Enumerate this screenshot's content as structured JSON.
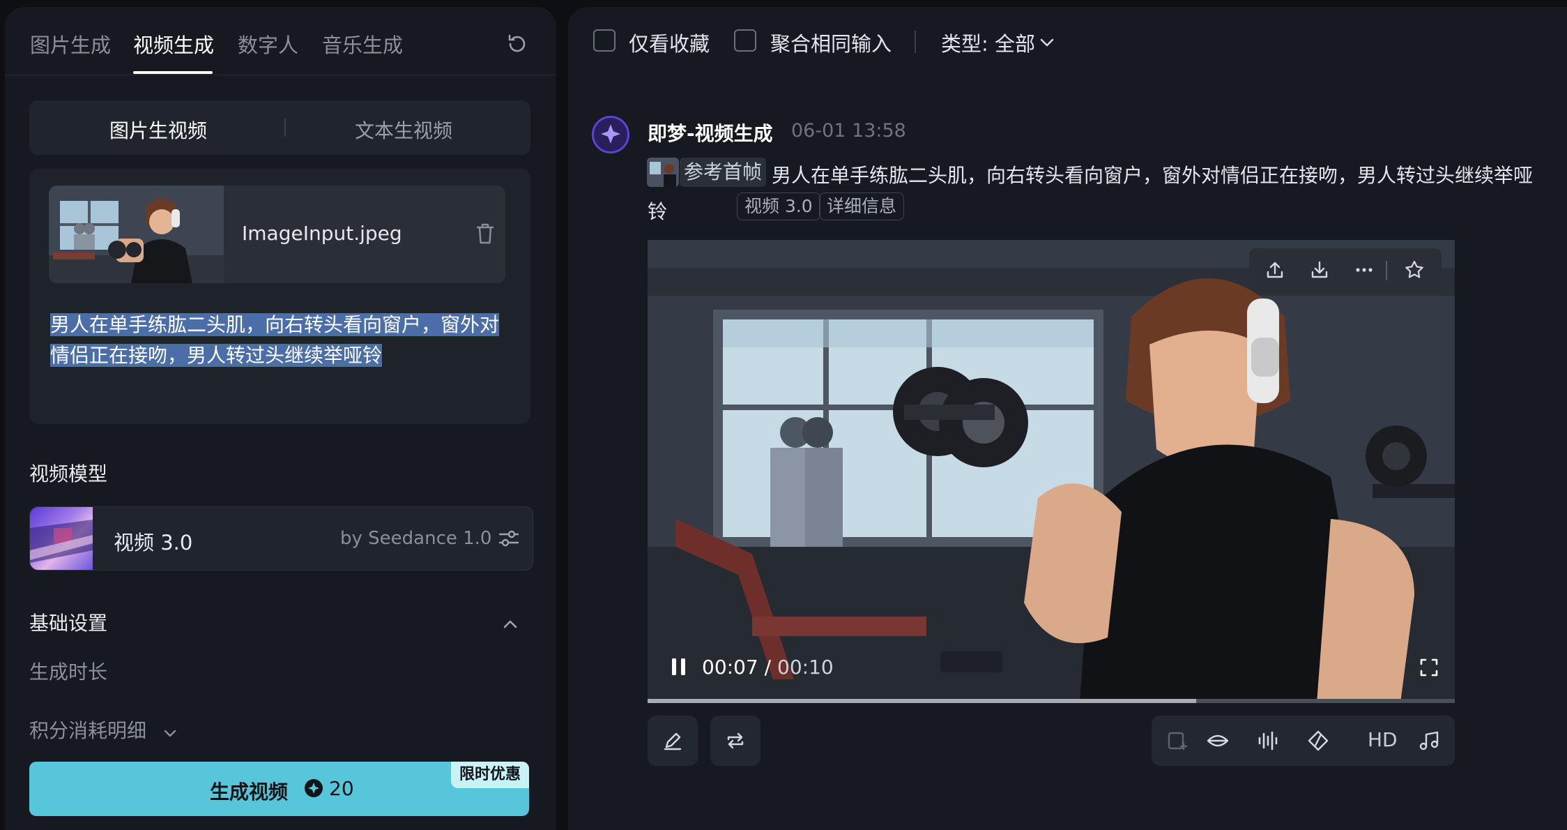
{
  "left": {
    "tabs": [
      {
        "label": "图片生成"
      },
      {
        "label": "视频生成"
      },
      {
        "label": "数字人"
      },
      {
        "label": "音乐生成"
      }
    ],
    "active_tab_index": 1,
    "seg": {
      "image_to_video": "图片生视频",
      "text_to_video": "文本生视频"
    },
    "input": {
      "file_name": "ImageInput.jpeg",
      "prompt": "男人在单手练肱二头肌，向右转头看向窗户，窗外对情侣正在接吻，男人转过头继续举哑铃"
    },
    "model_section": {
      "label": "视频模型",
      "name": "视频 3.0",
      "by": "by Seedance 1.0"
    },
    "basic_settings": {
      "label": "基础设置",
      "duration_label": "生成时长"
    },
    "points_detail": "积分消耗明细",
    "generate": {
      "label": "生成视频",
      "cost": "20",
      "promo": "限时优惠"
    }
  },
  "right": {
    "filters": {
      "favorites_only": "仅看收藏",
      "group_same_input": "聚合相同输入",
      "type_filter": "类型: 全部"
    },
    "message": {
      "sender": "即梦-视频生成",
      "time": "06-01  13:58",
      "ref_chip": "参考首帧",
      "prompt": "男人在单手练肱二头肌，向右转头看向窗户，窗外对情侣正在接吻，男人转过头继续举哑铃",
      "tags": [
        "视频 3.0",
        "详细信息"
      ]
    },
    "video": {
      "current_time": "00:07",
      "separator": "/",
      "total_time": "00:10",
      "progress": 0.68
    },
    "actions": {
      "hd_label": "HD"
    }
  },
  "colors": {
    "accent": "#57c6db",
    "promo_bg": "#c9f2f6",
    "highlight": "#4b6ea8",
    "avatar_ring": "#5a43d8"
  }
}
